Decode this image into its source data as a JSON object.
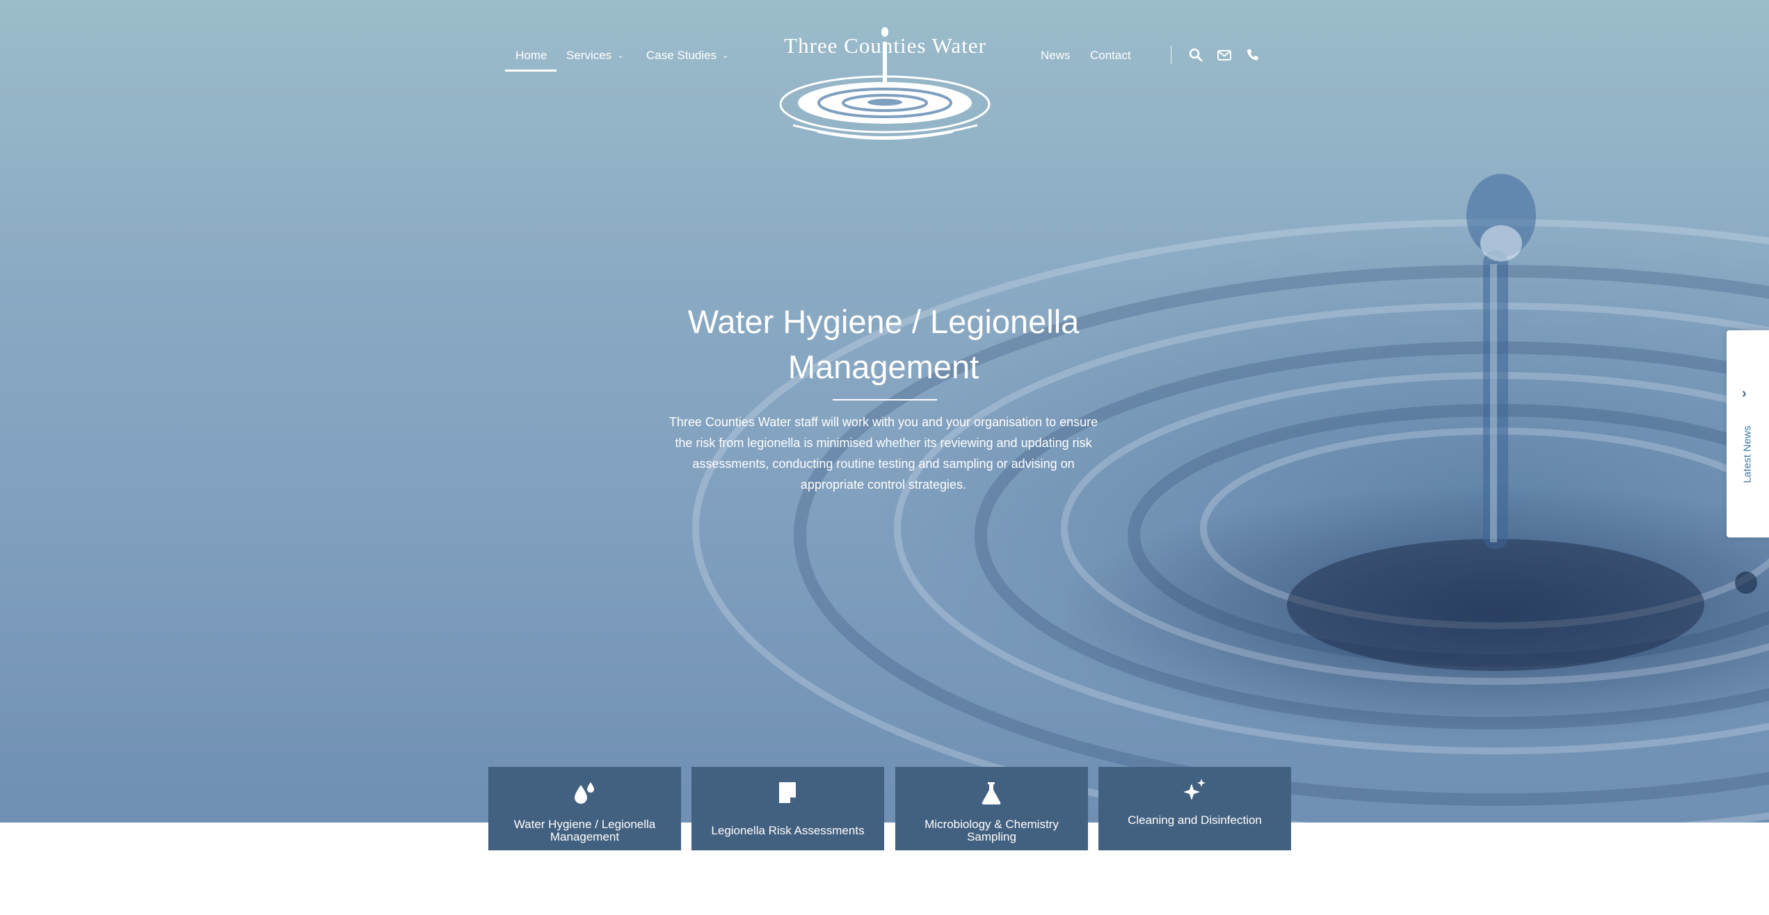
{
  "brand": {
    "name": "Three Counties Water"
  },
  "nav": {
    "items": [
      {
        "label": "Home",
        "active": true
      },
      {
        "label": "Services",
        "has_dropdown": true
      },
      {
        "label": "Case Studies",
        "has_dropdown": true
      },
      {
        "label": "News"
      },
      {
        "label": "Contact"
      }
    ],
    "icons": [
      "search-icon",
      "mail-icon",
      "phone-icon"
    ]
  },
  "hero": {
    "title_line1": "Water Hygiene / Legionella",
    "title_line2": "Management",
    "description": "Three Counties Water staff will work with you and your organisation to ensure the risk from legionella is minimised whether its reviewing and updating risk assessments, conducting routine testing and sampling or advising on appropriate control strategies."
  },
  "side_tab": {
    "label": "Latest News",
    "icon": "chevron-right-icon"
  },
  "services": [
    {
      "label": "Water Hygiene / Legionella Management",
      "icon": "water-drops-icon"
    },
    {
      "label": "Legionella Risk Assessments",
      "icon": "document-icon"
    },
    {
      "label": "Microbiology & Chemistry Sampling",
      "icon": "flask-icon"
    },
    {
      "label": "Cleaning and Disinfection",
      "icon": "sparkle-icon"
    }
  ],
  "colors": {
    "card_background": "#42607f",
    "side_tab_text": "#3d7aa6",
    "nav_text": "#ffffff"
  }
}
